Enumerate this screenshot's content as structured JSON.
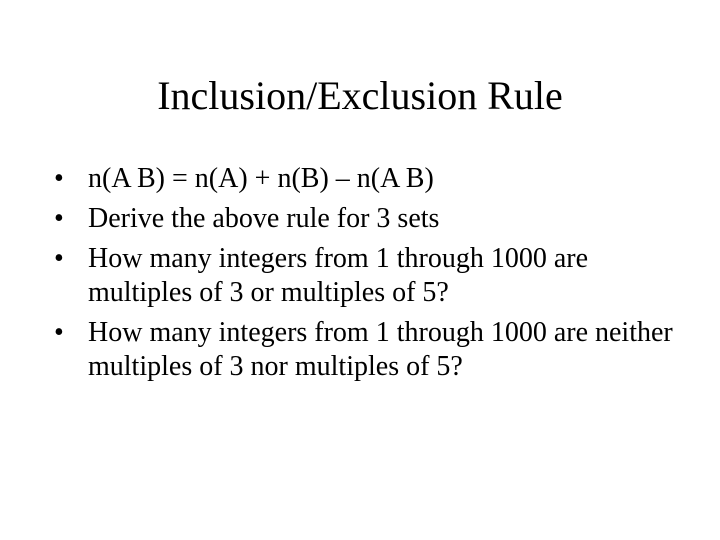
{
  "slide": {
    "title": "Inclusion/Exclusion Rule",
    "bullet_glyph": "•",
    "bullets": [
      {
        "text": "n(A B) = n(A) + n(B) – n(A B)"
      },
      {
        "text": "Derive the above rule for 3 sets"
      },
      {
        "text": "How many integers from 1 through 1000 are multiples of 3 or multiples of 5?"
      },
      {
        "text": "How many integers from 1 through 1000 are neither multiples of 3 nor multiples of 5?"
      }
    ]
  }
}
